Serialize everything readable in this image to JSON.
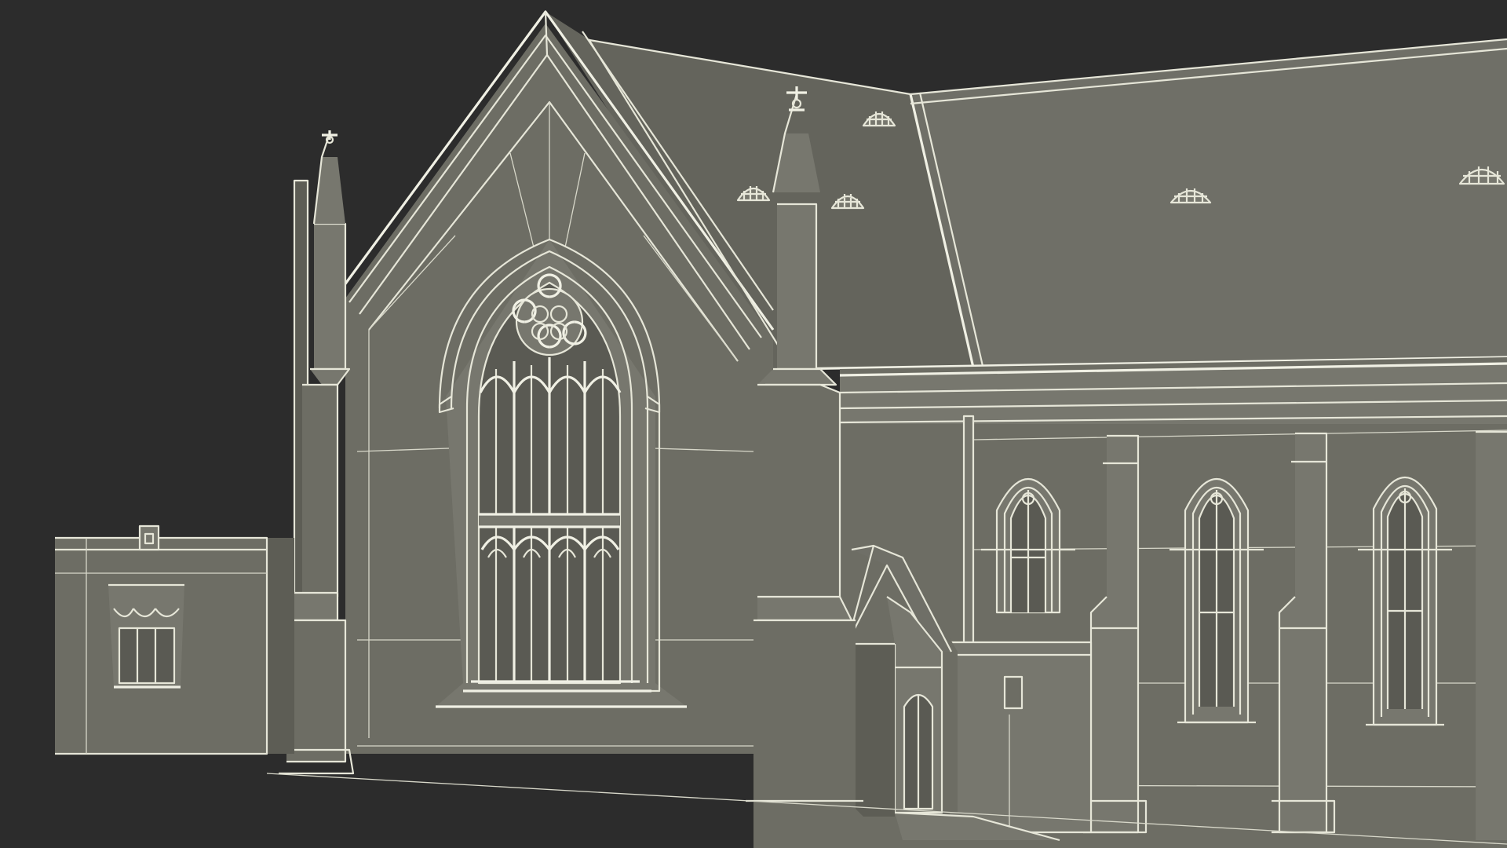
{
  "scene": {
    "subject": "gothic-church-wireframe-render",
    "colors": {
      "background": "#2c2c2c",
      "surface": "#6d6d64",
      "wireframe": "#e6e6d8"
    }
  }
}
